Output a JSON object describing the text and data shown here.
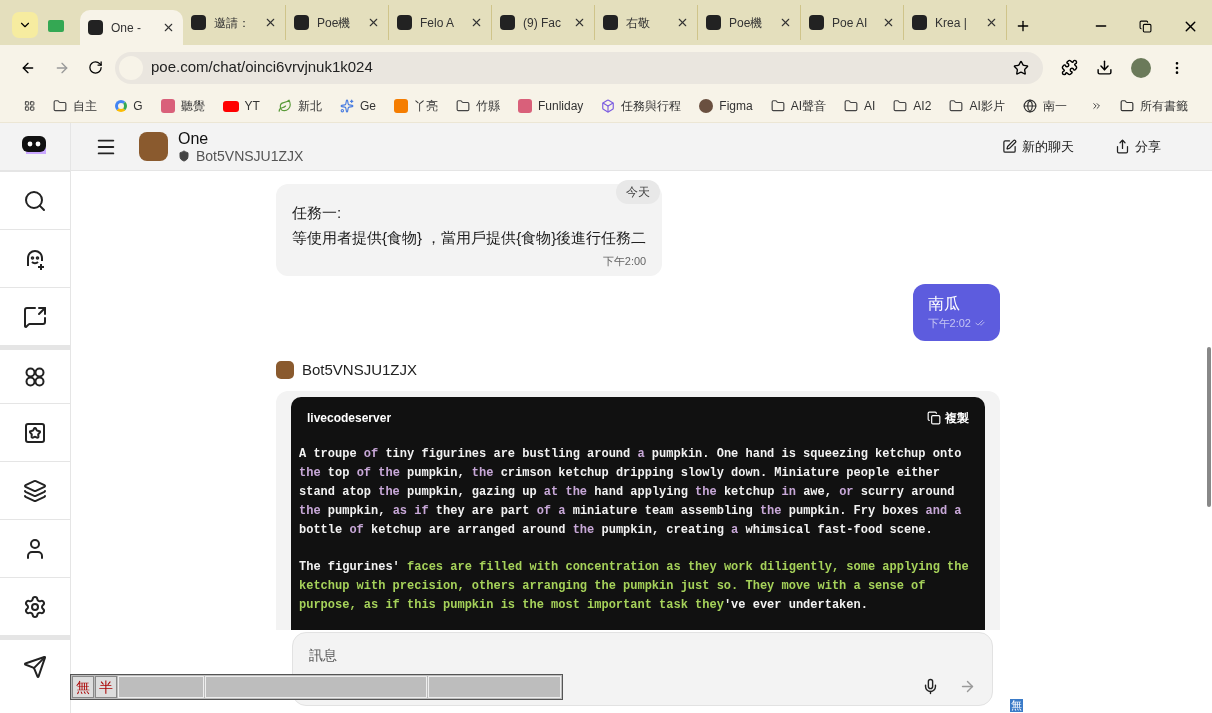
{
  "browser": {
    "tabs": [
      {
        "title": "One -",
        "selected": true
      },
      {
        "title": "邀請：",
        "selected": false
      },
      {
        "title": "Poe機",
        "selected": false
      },
      {
        "title": "Felo A",
        "selected": false
      },
      {
        "title": "(9) Fac",
        "selected": false
      },
      {
        "title": "右敬",
        "selected": false
      },
      {
        "title": "Poe機",
        "selected": false
      },
      {
        "title": "Poe AI",
        "selected": false
      },
      {
        "title": "Krea |",
        "selected": false
      }
    ],
    "address": "poe.com/chat/oinci6vrvjnuk1k024",
    "bookmarks": [
      {
        "label": "自主",
        "kind": "folder"
      },
      {
        "label": "G",
        "kind": "google"
      },
      {
        "label": "聽覺",
        "kind": "site"
      },
      {
        "label": "YT",
        "kind": "youtube"
      },
      {
        "label": "新北",
        "kind": "leaf"
      },
      {
        "label": "Ge",
        "kind": "sparkle"
      },
      {
        "label": "丫亮",
        "kind": "blogger"
      },
      {
        "label": "竹縣",
        "kind": "folder"
      },
      {
        "label": "Funliday",
        "kind": "site"
      },
      {
        "label": "任務與行程",
        "kind": "cube"
      },
      {
        "label": "Figma",
        "kind": "person"
      },
      {
        "label": "AI聲音",
        "kind": "folder"
      },
      {
        "label": "AI",
        "kind": "folder"
      },
      {
        "label": "AI2",
        "kind": "folder"
      },
      {
        "label": "AI影片",
        "kind": "folder"
      },
      {
        "label": "南一",
        "kind": "globe"
      }
    ],
    "all_bookmarks": "所有書籤"
  },
  "header": {
    "title": "One",
    "subtitle": "Bot5VNSJU1ZJX",
    "new_chat": "新的聊天",
    "share": "分享"
  },
  "date_label": "今天",
  "messages": [
    {
      "kind": "bot_text",
      "lines": [
        "任務一:",
        "等使用者提供{食物} ，當用戶提供{食物}後進行任務二"
      ],
      "time": "下午2:00"
    },
    {
      "kind": "user",
      "text": "南瓜",
      "time": "下午2:02"
    },
    {
      "kind": "bot_code",
      "author": "Bot5VNSJU1ZJX",
      "language": "livecodeserver",
      "copy": "複製",
      "paragraphs": [
        [
          [
            {
              "text": "A troupe ",
              "kind": "plain"
            },
            {
              "text": "of",
              "kind": "word"
            },
            {
              "text": " tiny figurines are bustling around ",
              "kind": "plain"
            },
            {
              "text": "a",
              "kind": "word"
            },
            {
              "text": " pumpkin. One hand is squeezing ketchup onto",
              "kind": "plain"
            }
          ],
          [
            {
              "text": "the",
              "kind": "word"
            },
            {
              "text": " top ",
              "kind": "plain"
            },
            {
              "text": "of the",
              "kind": "word"
            },
            {
              "text": " pumpkin, ",
              "kind": "plain"
            },
            {
              "text": "the",
              "kind": "word"
            },
            {
              "text": " crimson ketchup dripping slowly down. Miniature people either",
              "kind": "plain"
            }
          ],
          [
            {
              "text": "stand atop ",
              "kind": "plain"
            },
            {
              "text": "the",
              "kind": "word"
            },
            {
              "text": " pumpkin, gazing up ",
              "kind": "plain"
            },
            {
              "text": "at the",
              "kind": "word"
            },
            {
              "text": " hand applying ",
              "kind": "plain"
            },
            {
              "text": "the",
              "kind": "word"
            },
            {
              "text": " ketchup ",
              "kind": "plain"
            },
            {
              "text": "in",
              "kind": "word"
            },
            {
              "text": " awe, ",
              "kind": "plain"
            },
            {
              "text": "or",
              "kind": "word"
            },
            {
              "text": " scurry around",
              "kind": "plain"
            }
          ],
          [
            {
              "text": "the",
              "kind": "word"
            },
            {
              "text": " pumpkin, ",
              "kind": "plain"
            },
            {
              "text": "as if",
              "kind": "word"
            },
            {
              "text": " they are part ",
              "kind": "plain"
            },
            {
              "text": "of a",
              "kind": "word"
            },
            {
              "text": " miniature team assembling ",
              "kind": "plain"
            },
            {
              "text": "the",
              "kind": "word"
            },
            {
              "text": " pumpkin. Fry boxes ",
              "kind": "plain"
            },
            {
              "text": "and a",
              "kind": "word"
            }
          ],
          [
            {
              "text": "bottle ",
              "kind": "plain"
            },
            {
              "text": "of",
              "kind": "word"
            },
            {
              "text": " ketchup are arranged around ",
              "kind": "plain"
            },
            {
              "text": "the",
              "kind": "word"
            },
            {
              "text": " pumpkin, creating ",
              "kind": "plain"
            },
            {
              "text": "a",
              "kind": "word"
            },
            {
              "text": " whimsical fast-food scene.",
              "kind": "plain"
            }
          ]
        ],
        [
          [
            {
              "text": "The figurines' ",
              "kind": "plain"
            },
            {
              "text": "faces are filled with concentration as they work diligently, some applying the",
              "kind": "string"
            }
          ],
          [
            {
              "text": "ketchup with precision, others arranging the pumpkin just so. They move with a sense of",
              "kind": "string"
            }
          ],
          [
            {
              "text": "purpose, as if this pumpkin is the most important task they",
              "kind": "string"
            },
            {
              "text": "'ve ever undertaken.",
              "kind": "plain"
            }
          ]
        ]
      ]
    }
  ],
  "input": {
    "placeholder": "訊息"
  },
  "ime": {
    "mode": "無",
    "width": "半"
  },
  "tray": "無"
}
